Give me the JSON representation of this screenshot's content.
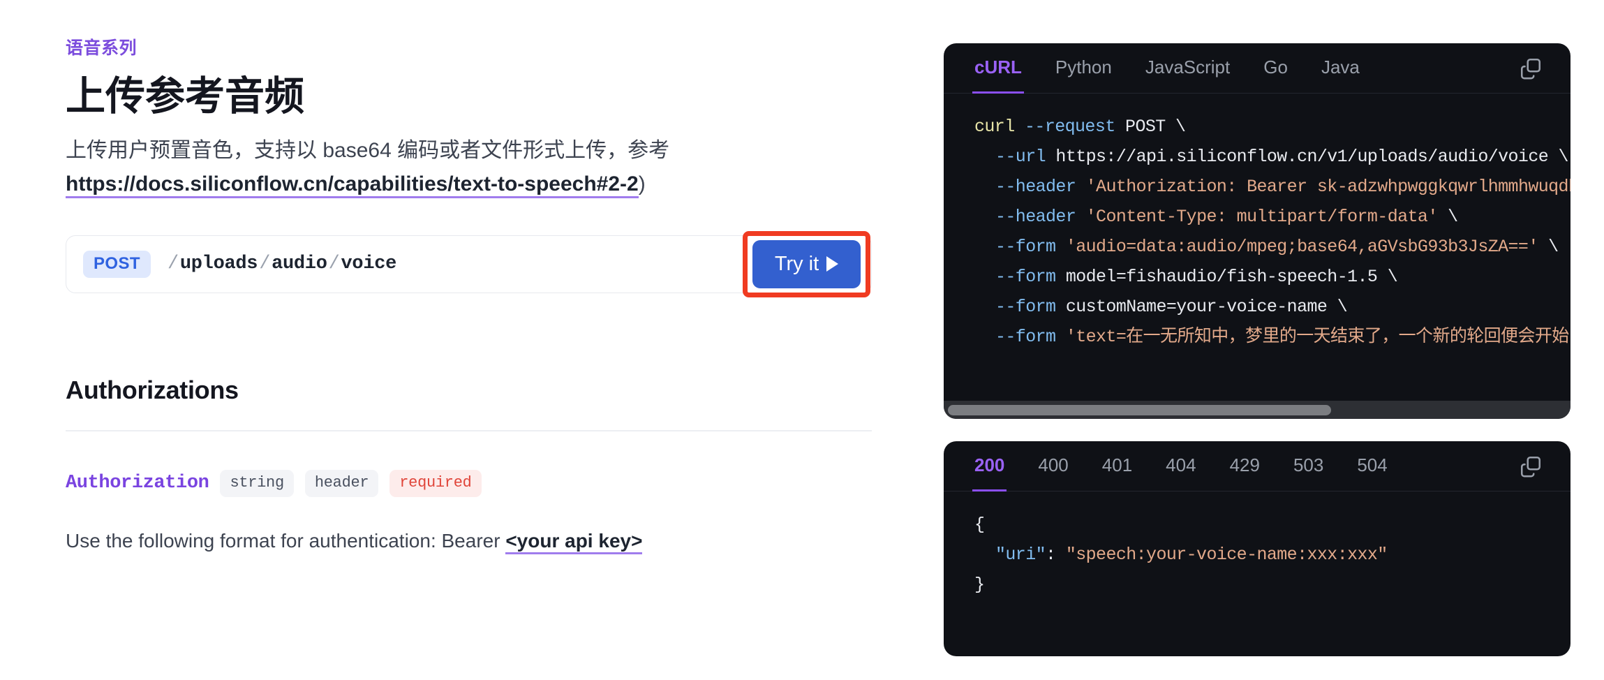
{
  "header": {
    "eyebrow": "语音系列",
    "title": "上传参考音频",
    "description_before": "上传用户预置音色，支持以 base64 编码或者文件形式上传，参考",
    "link_text": "https://docs.siliconflow.cn/capabilities/text-to-speech#2-2",
    "description_after": ")"
  },
  "endpoint": {
    "method": "POST",
    "path_segments": [
      "uploads",
      "audio",
      "voice"
    ],
    "path_display": "/uploads/audio/voice",
    "try_it_label": "Try it",
    "try_it_icon": "play-triangle-icon",
    "highlight_color": "#f03b21",
    "button_color": "#3360cf",
    "method_badge_color": "#2f62e0"
  },
  "authorizations": {
    "section_title": "Authorizations",
    "param_name": "Authorization",
    "pills": [
      {
        "label": "string",
        "style": "neutral"
      },
      {
        "label": "header",
        "style": "neutral"
      },
      {
        "label": "required",
        "style": "required"
      }
    ],
    "description_text": "Use the following format for authentication: Bearer ",
    "description_highlight": "<your api key>"
  },
  "request_panel": {
    "tabs": [
      {
        "label": "cURL",
        "active": true
      },
      {
        "label": "Python",
        "active": false
      },
      {
        "label": "JavaScript",
        "active": false
      },
      {
        "label": "Go",
        "active": false
      },
      {
        "label": "Java",
        "active": false
      }
    ],
    "copy_icon": "copy-icon",
    "accent_color": "#8b4ff5",
    "code_lines": [
      {
        "indent": 0,
        "tokens": [
          {
            "t": "curl ",
            "c": "cmd"
          },
          {
            "t": "--request",
            "c": "flag"
          },
          {
            "t": " POST \\",
            "c": "plain"
          }
        ]
      },
      {
        "indent": 1,
        "tokens": [
          {
            "t": "--url",
            "c": "flag"
          },
          {
            "t": " https://api.siliconflow.cn/v1/uploads/audio/voice \\",
            "c": "plain"
          }
        ]
      },
      {
        "indent": 1,
        "tokens": [
          {
            "t": "--header",
            "c": "flag"
          },
          {
            "t": " 'Authorization: Bearer sk-adzwhpwggkqwrlhmmhwuqdb",
            "c": "str"
          }
        ]
      },
      {
        "indent": 1,
        "tokens": [
          {
            "t": "--header",
            "c": "flag"
          },
          {
            "t": " 'Content-Type: multipart/form-data'",
            "c": "str"
          },
          {
            "t": " \\",
            "c": "plain"
          }
        ]
      },
      {
        "indent": 1,
        "tokens": [
          {
            "t": "--form",
            "c": "flag"
          },
          {
            "t": " 'audio=data:audio/mpeg;base64,aGVsbG93b3JsZA=='",
            "c": "str"
          },
          {
            "t": " \\",
            "c": "plain"
          }
        ]
      },
      {
        "indent": 1,
        "tokens": [
          {
            "t": "--form",
            "c": "flag"
          },
          {
            "t": " model=fishaudio/fish-speech-1.5 \\",
            "c": "plain"
          }
        ]
      },
      {
        "indent": 1,
        "tokens": [
          {
            "t": "--form",
            "c": "flag"
          },
          {
            "t": " customName=your-voice-name \\",
            "c": "plain"
          }
        ]
      },
      {
        "indent": 1,
        "tokens": [
          {
            "t": "--form",
            "c": "flag"
          },
          {
            "t": " 'text=在一无所知中，梦里的一天结束了，一个新的轮回便会开始'",
            "c": "str"
          }
        ]
      }
    ],
    "scrollbar": {
      "visible": true,
      "thumb_fraction": 0.62
    }
  },
  "response_panel": {
    "tabs": [
      {
        "label": "200",
        "active": true
      },
      {
        "label": "400",
        "active": false
      },
      {
        "label": "401",
        "active": false
      },
      {
        "label": "404",
        "active": false
      },
      {
        "label": "429",
        "active": false
      },
      {
        "label": "503",
        "active": false
      },
      {
        "label": "504",
        "active": false
      }
    ],
    "copy_icon": "copy-icon",
    "code_lines": [
      {
        "indent": 0,
        "tokens": [
          {
            "t": "{",
            "c": "punc"
          }
        ]
      },
      {
        "indent": 1,
        "tokens": [
          {
            "t": "\"uri\"",
            "c": "key"
          },
          {
            "t": ": ",
            "c": "punc"
          },
          {
            "t": "\"speech:your-voice-name:xxx:xxx\"",
            "c": "str"
          }
        ]
      },
      {
        "indent": 0,
        "tokens": [
          {
            "t": "}",
            "c": "punc"
          }
        ]
      }
    ]
  }
}
